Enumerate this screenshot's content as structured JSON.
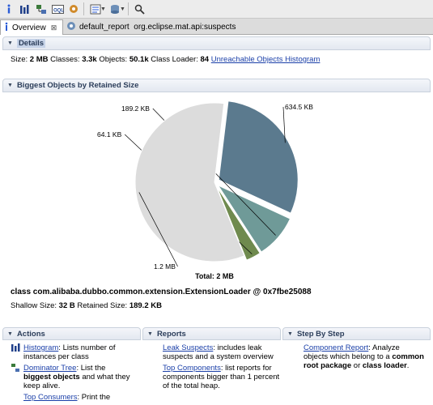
{
  "toolbar": {
    "icons": [
      "info-icon",
      "histogram-icon",
      "dominator-tree-icon",
      "oql-icon",
      "gear-icon",
      "query-browser-icon",
      "heap-dump-icon",
      "search-icon"
    ]
  },
  "tabs": [
    {
      "label": "Overview",
      "active": true
    },
    {
      "label": "default_report  org.eclipse.mat.api:suspects",
      "active": false
    }
  ],
  "details": {
    "header": "Details",
    "size_label": "Size:",
    "size_value": "2 MB",
    "classes_label": "Classes:",
    "classes_value": "3.3k",
    "objects_label": "Objects:",
    "objects_value": "50.1k",
    "loader_label": "Class Loader:",
    "loader_value": "84",
    "unreachable_link": "Unreachable Objects Histogram"
  },
  "biggest": {
    "header": "Biggest Objects by Retained Size",
    "class_line": "class com.alibaba.dubbo.common.extension.ExtensionLoader @ 0x7fbe25088",
    "shallow_label": "Shallow Size:",
    "shallow_value": "32 B",
    "retained_label": "Retained Size:",
    "retained_value": "189.2 KB"
  },
  "chart_data": {
    "type": "pie",
    "slices": [
      {
        "label": "634.5 KB",
        "value": 634.5,
        "color": "#5b7a8e",
        "exploded": true
      },
      {
        "label": "189.2 KB",
        "value": 189.2,
        "color": "#6f9a98",
        "exploded": true
      },
      {
        "label": "64.1 KB",
        "value": 64.1,
        "color": "#6f8a4e",
        "exploded": true
      },
      {
        "label": "1.2 MB",
        "value": 1228.8,
        "color": "#dcdcdc",
        "exploded": false
      }
    ],
    "total_label": "Total: 2 MB"
  },
  "actions": {
    "header": "Actions",
    "items": [
      {
        "link": "Histogram",
        "text": ": Lists number of instances per class"
      },
      {
        "link": "Dominator Tree",
        "text": ": List the",
        "bold": "biggest objects",
        "text2": "and what they keep alive."
      },
      {
        "link": "Top Consumers",
        "text": ": Print the"
      }
    ]
  },
  "reports": {
    "header": "Reports",
    "items": [
      {
        "link": "Leak Suspects",
        "text": ": includes leak suspects and a system overview"
      },
      {
        "link": "Top Components",
        "text": ": list reports for components bigger than 1 percent of the total heap."
      }
    ]
  },
  "stepbystep": {
    "header": "Step By Step",
    "items": [
      {
        "link": "Component Report",
        "text": ": Analyze objects which belong to a",
        "bold": "common root package",
        "text2": "or",
        "bold2": "class loader",
        "text3": "."
      }
    ]
  }
}
